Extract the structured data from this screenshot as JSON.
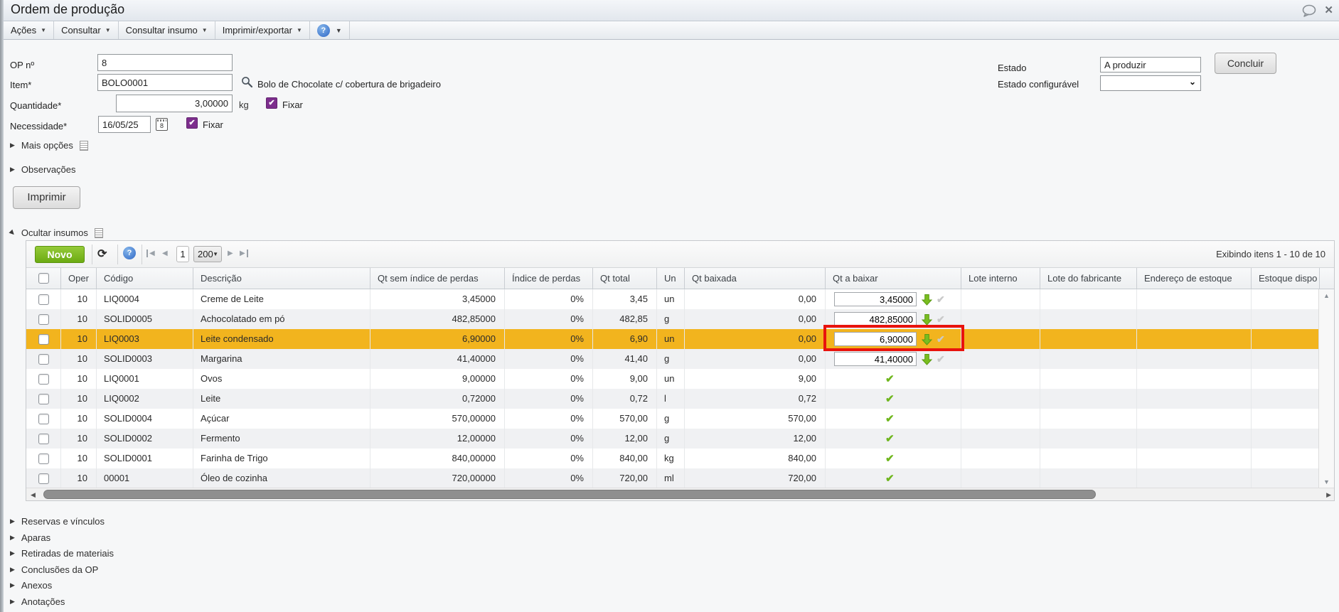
{
  "window": {
    "title": "Ordem de produção"
  },
  "menu": {
    "items": [
      "Ações",
      "Consultar",
      "Consultar insumo",
      "Imprimir/exportar"
    ],
    "help": "?"
  },
  "form": {
    "op_label": "OP nº",
    "op_value": "8",
    "item_label": "Item*",
    "item_value": "BOLO0001",
    "item_description": "Bolo de Chocolate c/ cobertura de brigadeiro",
    "qty_label": "Quantidade*",
    "qty_value": "3,00000",
    "qty_unit": "kg",
    "fixar_label": "Fixar",
    "fixar_checked": "✔",
    "need_label": "Necessidade*",
    "need_value": "16/05/25",
    "calendar_day": "8",
    "mais_opcoes_label": "Mais opções",
    "observacoes_label": "Observações",
    "imprimir_label": "Imprimir",
    "estado_label": "Estado",
    "estado_value": "A produzir",
    "estado_config_label": "Estado configurável",
    "estado_config_value": "",
    "concluir_label": "Concluir"
  },
  "insumos": {
    "section_label": "Ocultar insumos",
    "novo_label": "Novo",
    "page_value": "1",
    "page_size_value": "200",
    "items_info": "Exibindo itens 1 - 10 de 10",
    "columns": [
      "Oper",
      "Código",
      "Descrição",
      "Qt sem índice de perdas",
      "Índice de perdas",
      "Qt total",
      "Un",
      "Qt baixada",
      "Qt a baixar",
      "Lote interno",
      "Lote do fabricante",
      "Endereço de estoque",
      "Estoque dispo"
    ],
    "rows": [
      {
        "oper": "10",
        "codigo": "LIQ0004",
        "descricao": "Creme de Leite",
        "qt_sem_indice": "3,45000",
        "indice_perdas": "0%",
        "qt_total": "3,45",
        "un": "un",
        "qt_baixada": "0,00",
        "qt_a_baixar": "3,45000",
        "status": "pending",
        "highlighted": false,
        "annotated": false
      },
      {
        "oper": "10",
        "codigo": "SOLID0005",
        "descricao": "Achocolatado em pó",
        "qt_sem_indice": "482,85000",
        "indice_perdas": "0%",
        "qt_total": "482,85",
        "un": "g",
        "qt_baixada": "0,00",
        "qt_a_baixar": "482,85000",
        "status": "pending",
        "highlighted": false,
        "annotated": false
      },
      {
        "oper": "10",
        "codigo": "LIQ0003",
        "descricao": "Leite condensado",
        "qt_sem_indice": "6,90000",
        "indice_perdas": "0%",
        "qt_total": "6,90",
        "un": "un",
        "qt_baixada": "0,00",
        "qt_a_baixar": "6,90000",
        "status": "pending",
        "highlighted": true,
        "annotated": true
      },
      {
        "oper": "10",
        "codigo": "SOLID0003",
        "descricao": "Margarina",
        "qt_sem_indice": "41,40000",
        "indice_perdas": "0%",
        "qt_total": "41,40",
        "un": "g",
        "qt_baixada": "0,00",
        "qt_a_baixar": "41,40000",
        "status": "pending",
        "highlighted": false,
        "annotated": false
      },
      {
        "oper": "10",
        "codigo": "LIQ0001",
        "descricao": "Ovos",
        "qt_sem_indice": "9,00000",
        "indice_perdas": "0%",
        "qt_total": "9,00",
        "un": "un",
        "qt_baixada": "9,00",
        "qt_a_baixar": "",
        "status": "done",
        "highlighted": false,
        "annotated": false
      },
      {
        "oper": "10",
        "codigo": "LIQ0002",
        "descricao": "Leite",
        "qt_sem_indice": "0,72000",
        "indice_perdas": "0%",
        "qt_total": "0,72",
        "un": "l",
        "qt_baixada": "0,72",
        "qt_a_baixar": "",
        "status": "done",
        "highlighted": false,
        "annotated": false
      },
      {
        "oper": "10",
        "codigo": "SOLID0004",
        "descricao": "Açúcar",
        "qt_sem_indice": "570,00000",
        "indice_perdas": "0%",
        "qt_total": "570,00",
        "un": "g",
        "qt_baixada": "570,00",
        "qt_a_baixar": "",
        "status": "done",
        "highlighted": false,
        "annotated": false
      },
      {
        "oper": "10",
        "codigo": "SOLID0002",
        "descricao": "Fermento",
        "qt_sem_indice": "12,00000",
        "indice_perdas": "0%",
        "qt_total": "12,00",
        "un": "g",
        "qt_baixada": "12,00",
        "qt_a_baixar": "",
        "status": "done",
        "highlighted": false,
        "annotated": false
      },
      {
        "oper": "10",
        "codigo": "SOLID0001",
        "descricao": "Farinha de Trigo",
        "qt_sem_indice": "840,00000",
        "indice_perdas": "0%",
        "qt_total": "840,00",
        "un": "kg",
        "qt_baixada": "840,00",
        "qt_a_baixar": "",
        "status": "done",
        "highlighted": false,
        "annotated": false
      },
      {
        "oper": "10",
        "codigo": "00001",
        "descricao": "Óleo de cozinha",
        "qt_sem_indice": "720,00000",
        "indice_perdas": "0%",
        "qt_total": "720,00",
        "un": "ml",
        "qt_baixada": "720,00",
        "qt_a_baixar": "",
        "status": "done",
        "highlighted": false,
        "annotated": false
      }
    ]
  },
  "sections": [
    "Reservas e vínculos",
    "Aparas",
    "Retiradas de materiais",
    "Conclusões da OP",
    "Anexos",
    "Anotações"
  ],
  "icons": {
    "titlebar": [
      "speech-bubble-icon",
      "close-icon"
    ],
    "item_lookup": "magnifier-icon",
    "date_picker": "calendar-icon",
    "notes": "notes-icon",
    "toolbar": [
      "refresh-icon",
      "help-icon",
      "page-first-icon",
      "page-prev-icon",
      "page-next-icon",
      "page-last-icon"
    ],
    "row_action": "green-down-arrow-icon",
    "row_pending": "gray-check-icon",
    "row_done": "green-check-icon"
  },
  "colors": {
    "highlight_row": "#F2B41E",
    "annotation_box": "#E8130D",
    "novo_button": "#6CAB12",
    "check_green": "#6FB61E",
    "fixar_checkbox": "#7D2E8D"
  }
}
